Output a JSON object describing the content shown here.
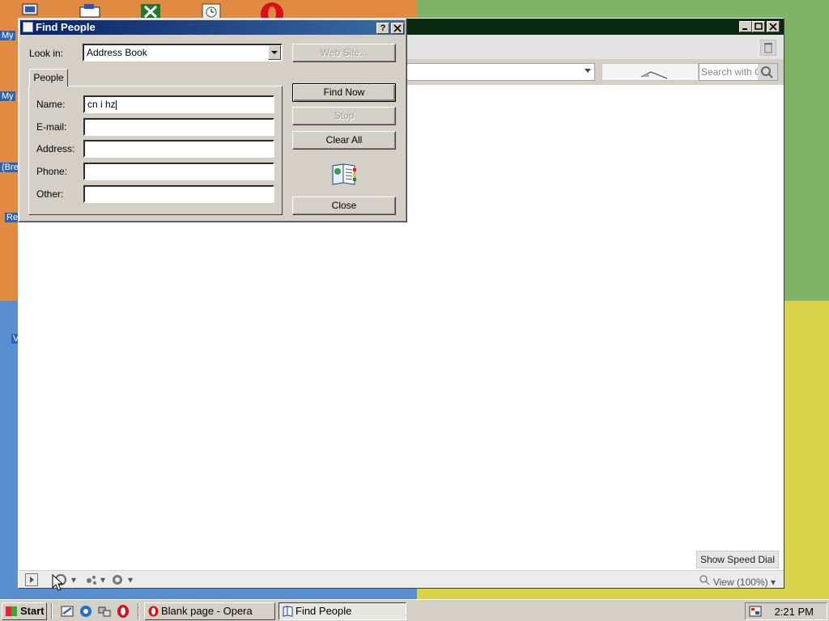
{
  "desktop": {
    "labels": [
      "My",
      "My",
      "(Bre",
      "Re",
      "V"
    ]
  },
  "opera": {
    "search_placeholder": "Search with Co",
    "speed_dial_label": "Show Speed Dial",
    "zoom_label": "View (100%)",
    "accent_color": "#0a2a10"
  },
  "dialog": {
    "title": "Find People",
    "help_button": "?",
    "close_x": "×",
    "look_in_label": "Look in:",
    "look_in_value": "Address Book",
    "tab_label": "People",
    "fields": [
      {
        "label": "Name:",
        "value": "cn i hz"
      },
      {
        "label": "E-mail:",
        "value": ""
      },
      {
        "label": "Address:",
        "value": ""
      },
      {
        "label": "Phone:",
        "value": ""
      },
      {
        "label": "Other:",
        "value": ""
      }
    ],
    "buttons": {
      "web_site": "Web Site...",
      "find_now": "Find Now",
      "stop": "Stop",
      "clear_all": "Clear All",
      "close": "Close"
    },
    "title_gradient_start": "#0a246a"
  },
  "taskbar": {
    "start_label": "Start",
    "tasks": [
      "Blank page - Opera",
      "Find People"
    ],
    "clock": "2:21 PM"
  }
}
